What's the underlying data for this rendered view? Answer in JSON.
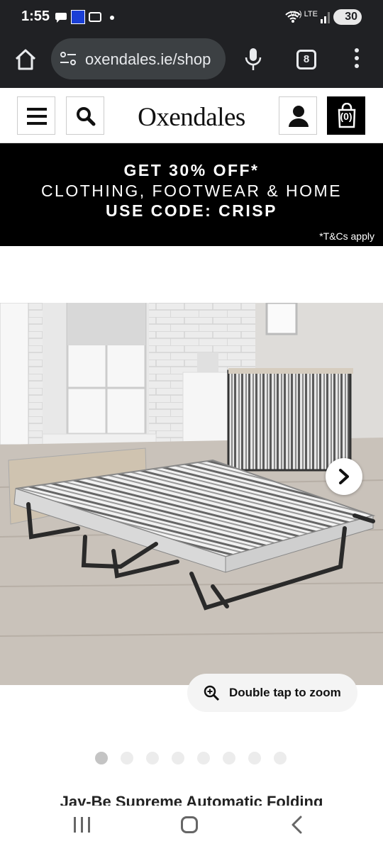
{
  "status_bar": {
    "time": "1:55",
    "signal_text": "Vo) LTE",
    "battery": "30"
  },
  "browser": {
    "url": "oxendales.ie/shop",
    "tab_count": "8"
  },
  "site": {
    "brand": "Oxendales",
    "bag_count": "(0)"
  },
  "promo": {
    "line1": "GET 30% OFF*",
    "line2": "CLOTHING, FOOTWEAR & HOME",
    "line3": "USE CODE: CRISP",
    "terms": "*T&Cs apply"
  },
  "product": {
    "zoom_hint": "Double tap to zoom",
    "image_count": 8,
    "active_image": 0,
    "title_partial": "Jay-Be Supreme Automatic Folding"
  },
  "icons": {
    "home": "home-icon",
    "tune": "tune-icon",
    "mic": "mic-icon",
    "menu": "more-vert-icon",
    "hamburger": "hamburger-menu-icon",
    "search": "search-icon",
    "account": "account-icon",
    "bag": "shopping-bag-icon",
    "next": "chevron-right-icon",
    "zoom": "zoom-in-icon"
  },
  "colors": {
    "promo_bg": "#000000",
    "browser_chrome": "#202124"
  }
}
